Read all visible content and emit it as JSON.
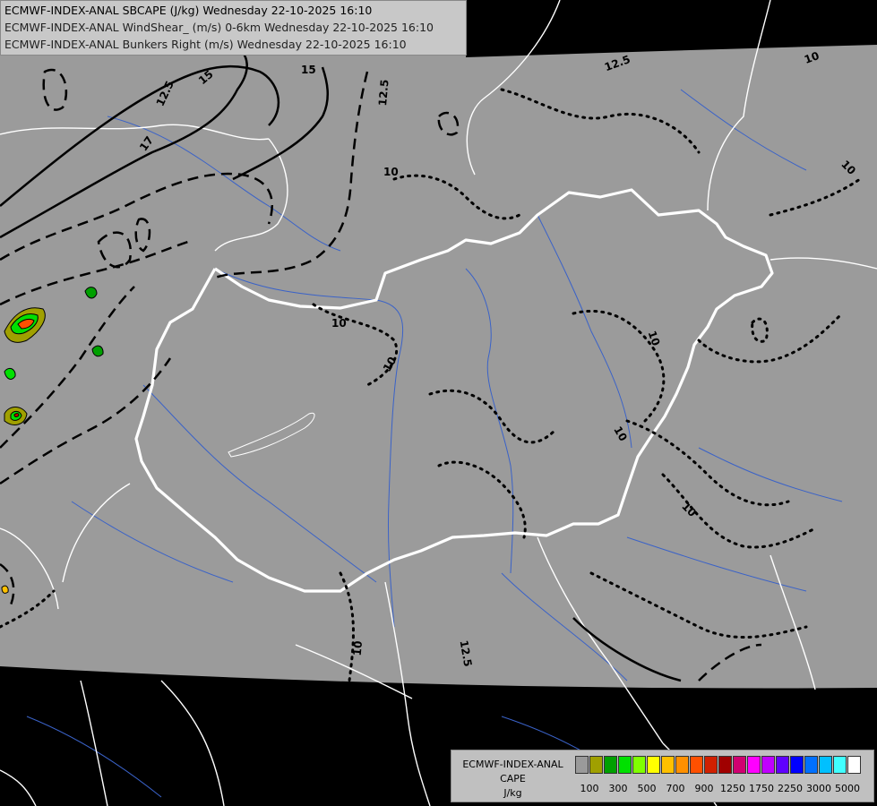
{
  "header": {
    "line1": "ECMWF-INDEX-ANAL SBCAPE (J/kg) Wednesday 22-10-2025 16:10",
    "line2": "ECMWF-INDEX-ANAL WindShear_ (m/s) 0-6km Wednesday 22-10-2025 16:10",
    "line3": "ECMWF-INDEX-ANAL Bunkers Right (m/s) Wednesday 22-10-2025 16:10"
  },
  "contour_labels": [
    "17",
    "15",
    "15",
    "12.5",
    "12.5",
    "12.5",
    "12.5",
    "10",
    "10",
    "10",
    "10",
    "10",
    "10",
    "10",
    "10",
    "10"
  ],
  "legend": {
    "source": "ECMWF-INDEX-ANAL",
    "parameter": "CAPE",
    "unit": "J/kg",
    "colors": [
      "#9a9a9a",
      "#a0a000",
      "#00a000",
      "#00e000",
      "#80ff00",
      "#ffff00",
      "#ffc000",
      "#ff9000",
      "#ff5000",
      "#d02000",
      "#a00000",
      "#d00070",
      "#ff00ff",
      "#c000ff",
      "#6000ff",
      "#0000ff",
      "#0070ff",
      "#00c0ff",
      "#40ffff",
      "#ffffff"
    ],
    "ticks": [
      "100",
      "300",
      "500",
      "700",
      "900",
      "1250",
      "1750",
      "2250",
      "3000",
      "5000"
    ]
  },
  "colors": {
    "background": "#000000",
    "domain": "#9b9b9b",
    "border": "#ffffff",
    "river": "#3a62c8",
    "contour": "#000000"
  }
}
